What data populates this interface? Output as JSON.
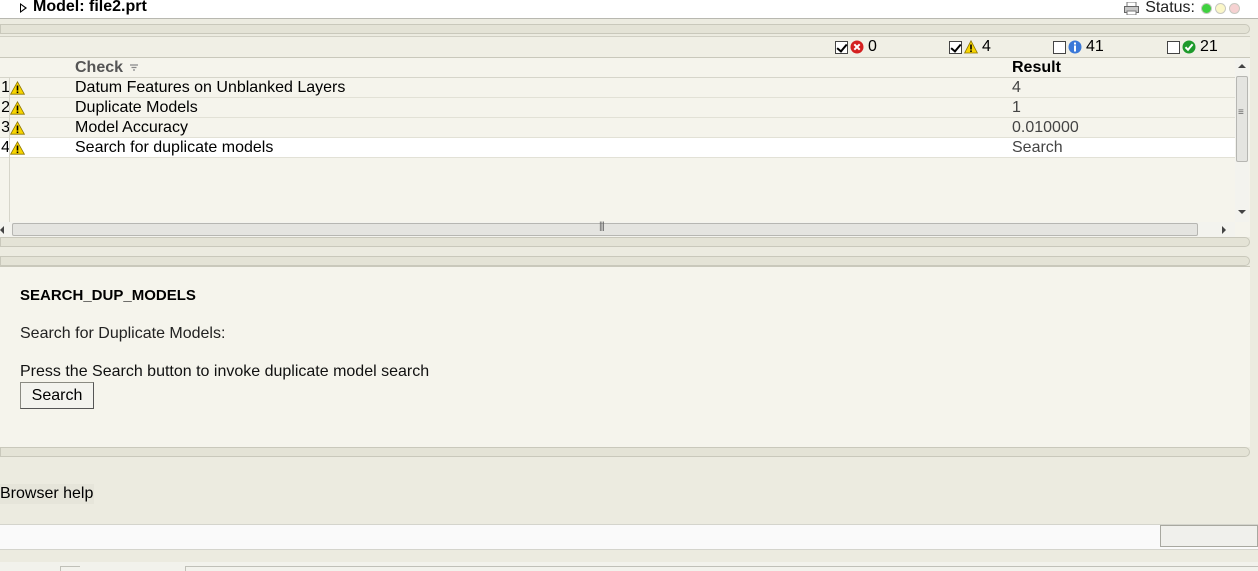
{
  "model": {
    "title": "Model: file2.prt",
    "status_label": "Status:"
  },
  "status_lights": [
    "green",
    "yellow",
    "red"
  ],
  "filters": [
    {
      "name": "errors",
      "icon": "error-icon",
      "checked": true,
      "count": "0"
    },
    {
      "name": "warnings",
      "icon": "warning-icon",
      "checked": true,
      "count": "4"
    },
    {
      "name": "info",
      "icon": "info-icon",
      "checked": false,
      "count": "41"
    },
    {
      "name": "ok",
      "icon": "ok-icon",
      "checked": false,
      "count": "21"
    }
  ],
  "table": {
    "headers": {
      "check": "Check",
      "result": "Result"
    },
    "rows": [
      {
        "num": "1",
        "icon": "warning-icon",
        "check": "Datum Features on Unblanked Layers",
        "result": "4"
      },
      {
        "num": "2",
        "icon": "warning-icon",
        "check": "Duplicate Models",
        "result": "1"
      },
      {
        "num": "3",
        "icon": "warning-icon",
        "check": "Model Accuracy",
        "result": "0.010000"
      },
      {
        "num": "4",
        "icon": "warning-icon",
        "check": "Search for duplicate models",
        "result": "Search"
      }
    ]
  },
  "detail": {
    "code": "SEARCH_DUP_MODELS",
    "title": "Search for Duplicate Models:",
    "description": "Press the Search button to invoke duplicate model search",
    "button_label": "Search"
  },
  "footer": {
    "browser_help": "Browser help"
  }
}
